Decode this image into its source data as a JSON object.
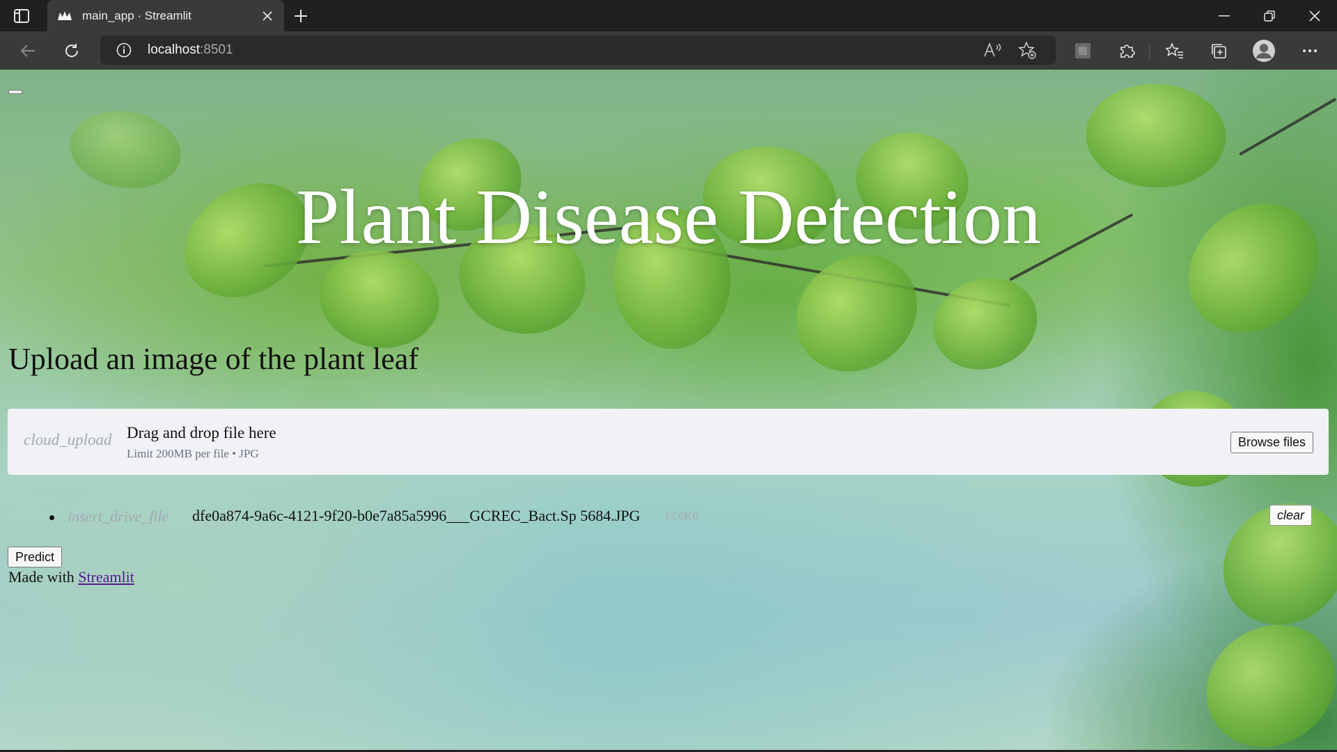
{
  "browser": {
    "tab_title": "main_app · Streamlit",
    "url_host": "localhost",
    "url_port": ":8501"
  },
  "icons": {
    "tab_actions": "vertical-tabs-icon",
    "favicon": "streamlit-crown-icon",
    "tab_close": "close-icon",
    "new_tab": "plus-icon",
    "minimize": "minimize-icon",
    "restore": "restore-icon",
    "close_window": "close-icon",
    "back": "back-arrow-icon",
    "refresh": "refresh-icon",
    "site_info": "info-icon",
    "read_aloud": "read-aloud-icon",
    "add_favorite": "star-plus-icon",
    "app_square": "square-icon",
    "extensions": "puzzle-icon",
    "favorites": "favorites-icon",
    "collections": "collections-icon",
    "profile": "avatar-icon",
    "more": "ellipsis-icon"
  },
  "app": {
    "title": "Plant Disease Detection",
    "subheading": "Upload an image of the plant leaf",
    "uploader": {
      "icon_text": "cloud_upload",
      "drag_text": "Drag and drop file here",
      "limit_text": "Limit 200MB per file • JPG",
      "browse_label": "Browse files"
    },
    "file": {
      "icon_text": "insert_drive_file",
      "name": "dfe0a874-9a6c-4121-9f20-b0e7a85a5996___GCREC_Bact.Sp 5684.JPG",
      "size": "13.6KB",
      "clear_label": "clear"
    },
    "predict_label": "Predict",
    "footer_prefix": "Made with ",
    "footer_link": "Streamlit"
  },
  "colors": {
    "chrome_dark": "#202020",
    "chrome_toolbar": "#3a3a3a",
    "dropzone_bg": "#f0f2f6",
    "title_text": "#ffffff",
    "link": "#551a8b"
  }
}
